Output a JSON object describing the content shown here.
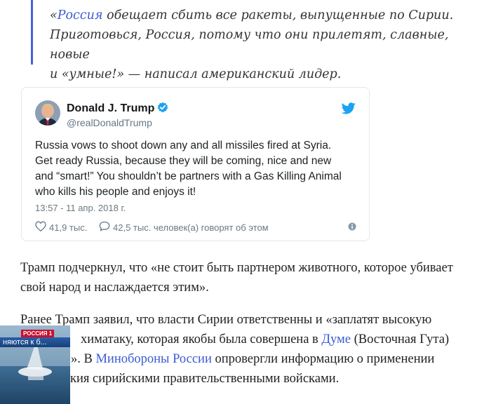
{
  "quote": {
    "line1_open": "«",
    "link1": "Россия",
    "line1_rest": " обещает сбить все ракеты, выпущенные по Сирии.",
    "line2": "Приготовься, Россия, потому что они прилетят, славные, новые",
    "line3": "и «умные!» — написал американский лидер."
  },
  "tweet": {
    "author_name": "Donald J. Trump",
    "author_handle": "@realDonaldTrump",
    "text_lines": [
      "Russia vows to shoot down any and all missiles fired at Syria.",
      "Get ready Russia,  because they will be coming, nice and new",
      "and “smart!” You shouldn’t be partners with a Gas Killing Animal",
      "who kills his people and enjoys it!"
    ],
    "timestamp": "13:57 - 11 апр. 2018 г.",
    "likes": "41,9 тыс.",
    "replies": "42,5 тыс. человек(а) говорят об этом",
    "colors": {
      "brand": "#1da1f2",
      "verified": "#1da1f2"
    }
  },
  "article": {
    "p1_line1": "Трамп подчеркнул, что «не стоит быть партнером животного, которое убивает",
    "p1_line2": "свой народ и наслаждается этим».",
    "p2_line1": "Ранее Трамп заявил, что власти Сирии ответственны и «заплатят высокую",
    "p2_line2_a": "химатаку, которая якобы была совершена в ",
    "p2_link_duma": "Думе",
    "p2_line2_b": " (Восточная Гута)",
    "p2_line3_a": "». В ",
    "p2_link_mod": "Минобороны России",
    "p2_line3_b": " опровергли информацию о применении",
    "p2_line4": "кия сирийскими правительственными войсками."
  },
  "video": {
    "channel_badge": "РОССИЯ 1",
    "ticker_text": "няются к б..."
  }
}
